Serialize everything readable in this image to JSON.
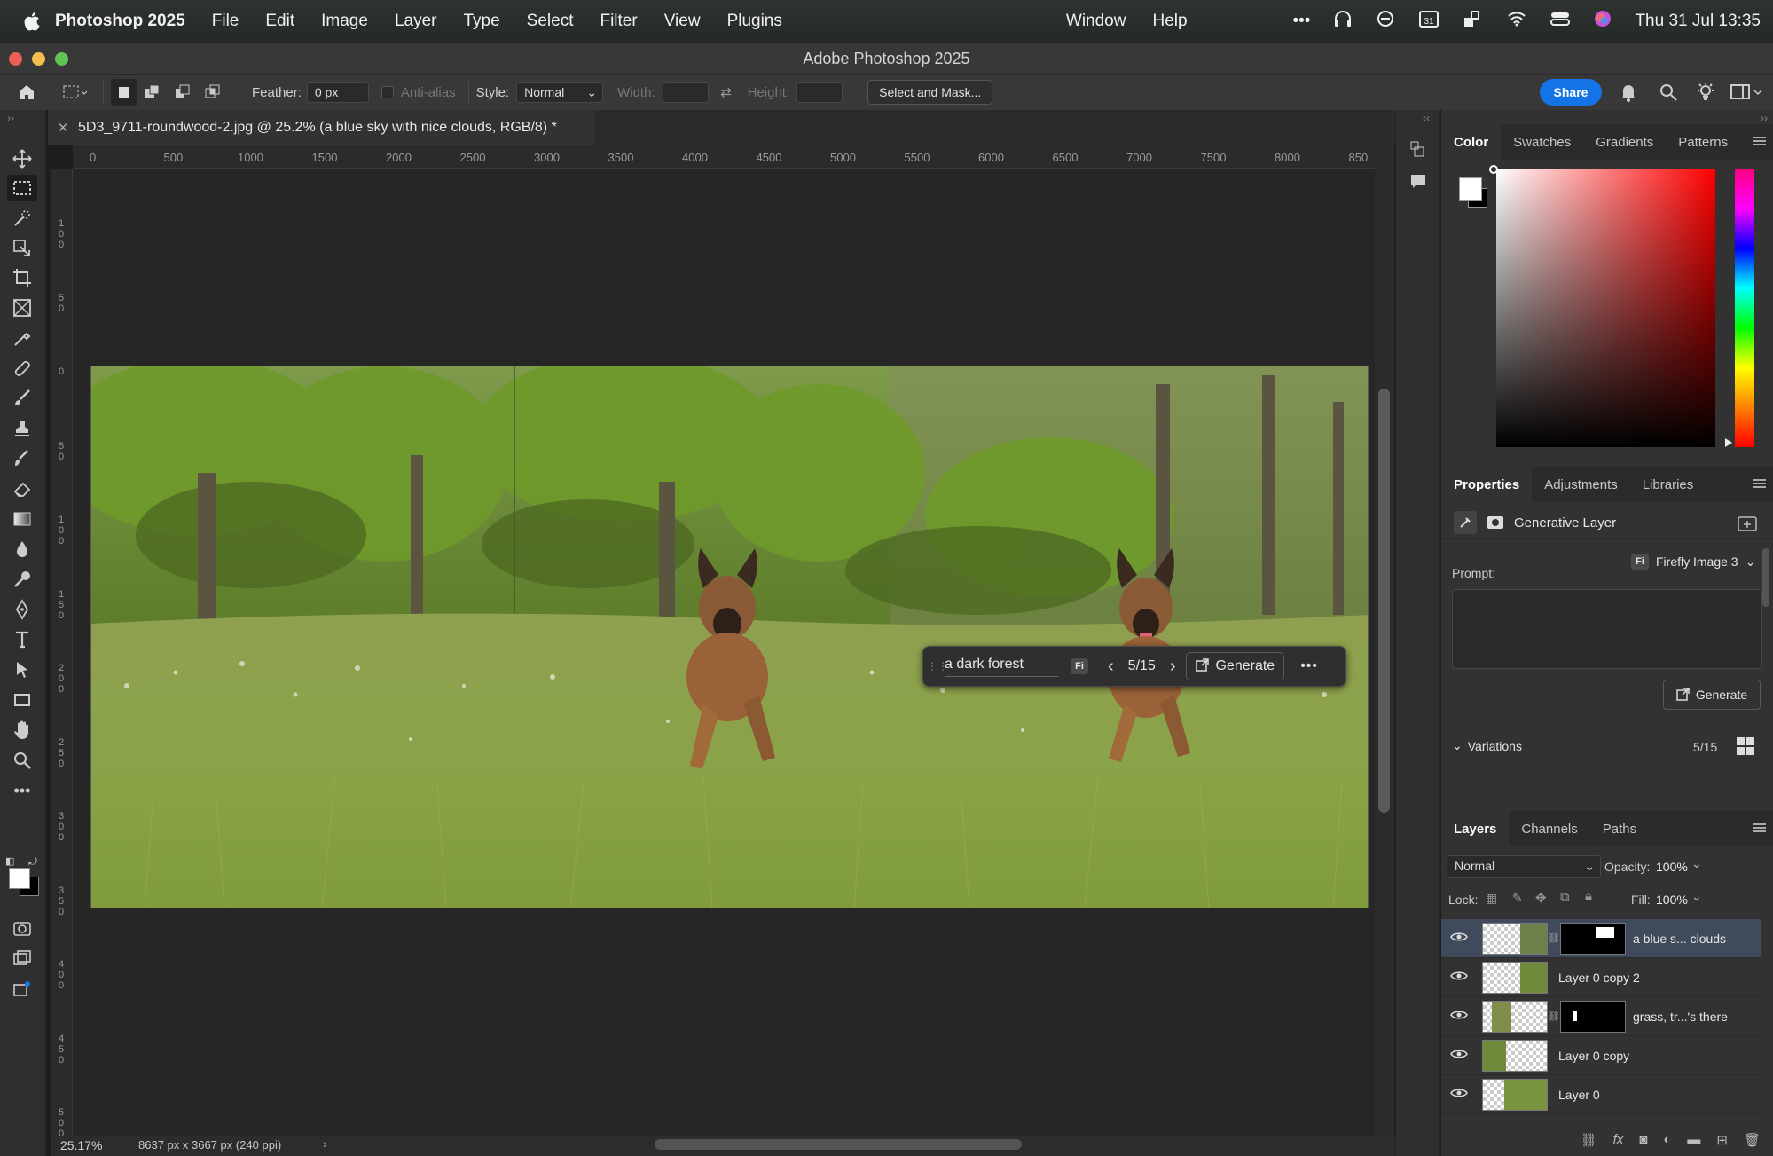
{
  "menubar": {
    "app": "Photoshop 2025",
    "items": [
      "File",
      "Edit",
      "Image",
      "Layer",
      "Type",
      "Select",
      "Filter",
      "View",
      "Plugins",
      "Window",
      "Help"
    ],
    "datetime": "Thu 31 Jul  13:35"
  },
  "titlebar": {
    "title": "Adobe Photoshop 2025"
  },
  "options": {
    "feather_label": "Feather:",
    "feather_value": "0 px",
    "antialias_label": "Anti-alias",
    "style_label": "Style:",
    "style_value": "Normal",
    "width_label": "Width:",
    "height_label": "Height:",
    "select_mask": "Select and Mask...",
    "share": "Share"
  },
  "document": {
    "tab_title": "5D3_9711-roundwood-2.jpg @ 25.2% (a blue sky with nice clouds, RGB/8) *",
    "zoom": "25.17%",
    "dimensions": "8637 px x 3667 px (240 ppi)"
  },
  "ruler": {
    "top": [
      "0",
      "500",
      "1000",
      "1500",
      "2000",
      "2500",
      "3000",
      "3500",
      "4000",
      "4500",
      "5000",
      "5500",
      "6000",
      "6500",
      "7000",
      "7500",
      "8000",
      "850"
    ],
    "left": [
      "100",
      "50",
      "0",
      "50",
      "100",
      "150",
      "200",
      "250",
      "300",
      "350",
      "400",
      "450",
      "500"
    ]
  },
  "contextbar": {
    "prompt": "a dark forest",
    "badge": "Fi",
    "counter": "5/15",
    "generate": "Generate"
  },
  "color_panel": {
    "tabs": [
      "Color",
      "Swatches",
      "Gradients",
      "Patterns"
    ]
  },
  "properties": {
    "tabs": [
      "Properties",
      "Adjustments",
      "Libraries"
    ],
    "layer_type": "Generative Layer",
    "prompt_label": "Prompt:",
    "model": "Firefly Image 3",
    "model_badge": "Fi",
    "generate": "Generate",
    "variations_label": "Variations",
    "variations_count": "5/15"
  },
  "layers_panel": {
    "tabs": [
      "Layers",
      "Channels",
      "Paths"
    ],
    "blend_mode": "Normal",
    "opacity_label": "Opacity:",
    "opacity": "100%",
    "lock_label": "Lock:",
    "fill_label": "Fill:",
    "fill": "100%",
    "layers": [
      {
        "name": "a blue s... clouds",
        "selected": true
      },
      {
        "name": "Layer 0 copy 2",
        "selected": false
      },
      {
        "name": "grass, tr...'s there",
        "selected": false
      },
      {
        "name": "Layer 0 copy",
        "selected": false
      },
      {
        "name": "Layer 0",
        "selected": false
      }
    ]
  },
  "colors": {
    "accent": "#1473e6",
    "selected_layer": "#3f4a5a"
  }
}
